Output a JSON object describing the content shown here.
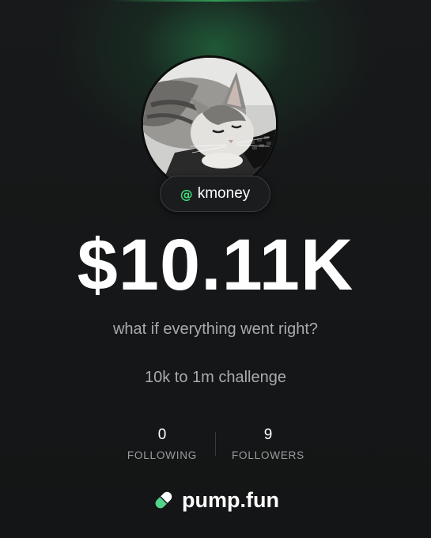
{
  "profile": {
    "handle_prefix": "@",
    "handle": "kmoney",
    "balance": "$10.11K",
    "tagline": "what if everything went right?",
    "bio": "10k to 1m challenge",
    "avatar": "avatar-photo"
  },
  "stats": {
    "following_count": "0",
    "following_label": "FOLLOWING",
    "followers_count": "9",
    "followers_label": "FOLLOWERS"
  },
  "brand": {
    "name": "pump.fun",
    "icon": "pill-icon"
  },
  "colors": {
    "background": "#151617",
    "accent_green": "#3ddc7a",
    "muted_text": "#a9aaab",
    "glow": "#288c50"
  }
}
